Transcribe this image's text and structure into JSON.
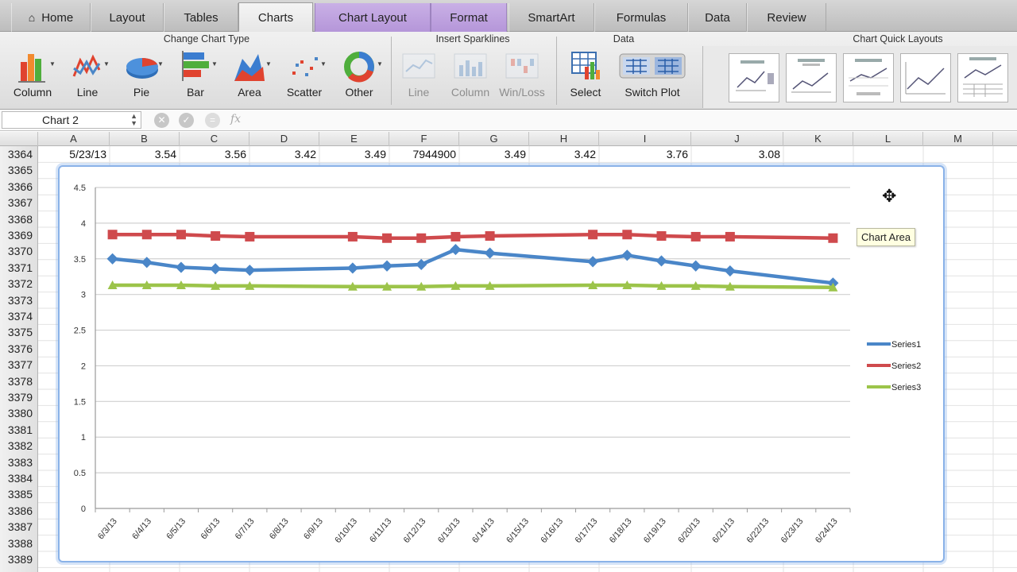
{
  "tabs": [
    {
      "label": "Home",
      "x": 0
    },
    {
      "label": "Layout"
    },
    {
      "label": "Tables"
    },
    {
      "label": "Charts"
    },
    {
      "label": "Chart Layout"
    },
    {
      "label": "Format"
    },
    {
      "label": "SmartArt"
    },
    {
      "label": "Formulas"
    },
    {
      "label": "Data"
    },
    {
      "label": "Review"
    }
  ],
  "ribbon": {
    "groups": {
      "change_chart_type": "Change Chart Type",
      "insert_sparklines": "Insert Sparklines",
      "data": "Data",
      "chart_quick_layouts": "Chart Quick Layouts"
    },
    "buttons": {
      "column": "Column",
      "line": "Line",
      "pie": "Pie",
      "bar": "Bar",
      "area": "Area",
      "scatter": "Scatter",
      "other": "Other",
      "spark_line": "Line",
      "spark_column": "Column",
      "spark_winloss": "Win/Loss",
      "select": "Select",
      "switch_plot": "Switch Plot"
    }
  },
  "formula_bar": {
    "name_box": "Chart 2",
    "fx": "fx"
  },
  "columns": [
    "A",
    "B",
    "C",
    "D",
    "E",
    "F",
    "G",
    "H",
    "I",
    "J",
    "K",
    "L",
    "M"
  ],
  "rows": [
    "3364",
    "3365",
    "3366",
    "3367",
    "3368",
    "3369",
    "3370",
    "3371",
    "3372",
    "3373",
    "3374",
    "3375",
    "3376",
    "3377",
    "3378",
    "3379",
    "3380",
    "3381",
    "3382",
    "3383",
    "3384",
    "3385",
    "3386",
    "3387",
    "3388",
    "3389"
  ],
  "row_3364": {
    "A": "5/23/13",
    "B": "3.54",
    "C": "3.56",
    "D": "3.42",
    "E": "3.49",
    "F": "7944900",
    "G": "3.49",
    "H": "3.42",
    "I": "3.76",
    "J": "3.08"
  },
  "tooltip": "Chart Area",
  "colors": {
    "series1": "#4a86c8",
    "series2": "#cf4a4d",
    "series3": "#9cc44a",
    "selection": "#8ab2e8"
  },
  "chart_data": {
    "type": "line",
    "title": "",
    "xlabel": "",
    "ylabel": "",
    "ylim": [
      0,
      4.5
    ],
    "yticks": [
      "0",
      "0.5",
      "1",
      "1.5",
      "2",
      "2.5",
      "3",
      "3.5",
      "4",
      "4.5"
    ],
    "grid": true,
    "legend": "right",
    "categories": [
      "6/3/13",
      "6/4/13",
      "6/5/13",
      "6/6/13",
      "6/7/13",
      "6/8/13",
      "6/9/13",
      "6/10/13",
      "6/11/13",
      "6/12/13",
      "6/13/13",
      "6/14/13",
      "6/15/13",
      "6/16/13",
      "6/17/13",
      "6/18/13",
      "6/19/13",
      "6/20/13",
      "6/21/13",
      "6/22/13",
      "6/23/13",
      "6/24/13"
    ],
    "series": [
      {
        "name": "Series1",
        "values": [
          3.5,
          3.45,
          3.38,
          3.36,
          3.34,
          null,
          null,
          3.37,
          3.4,
          3.42,
          3.63,
          3.58,
          null,
          null,
          3.46,
          3.55,
          3.47,
          3.4,
          3.33,
          null,
          null,
          3.16
        ]
      },
      {
        "name": "Series2",
        "values": [
          3.84,
          3.84,
          3.84,
          3.82,
          3.81,
          null,
          null,
          3.81,
          3.79,
          3.79,
          3.81,
          3.82,
          null,
          null,
          3.84,
          3.84,
          3.82,
          3.81,
          3.81,
          null,
          null,
          3.79
        ]
      },
      {
        "name": "Series3",
        "values": [
          3.13,
          3.13,
          3.13,
          3.12,
          3.12,
          null,
          null,
          3.11,
          3.11,
          3.11,
          3.12,
          3.12,
          null,
          null,
          3.13,
          3.13,
          3.12,
          3.12,
          3.11,
          null,
          null,
          3.1
        ]
      }
    ]
  }
}
